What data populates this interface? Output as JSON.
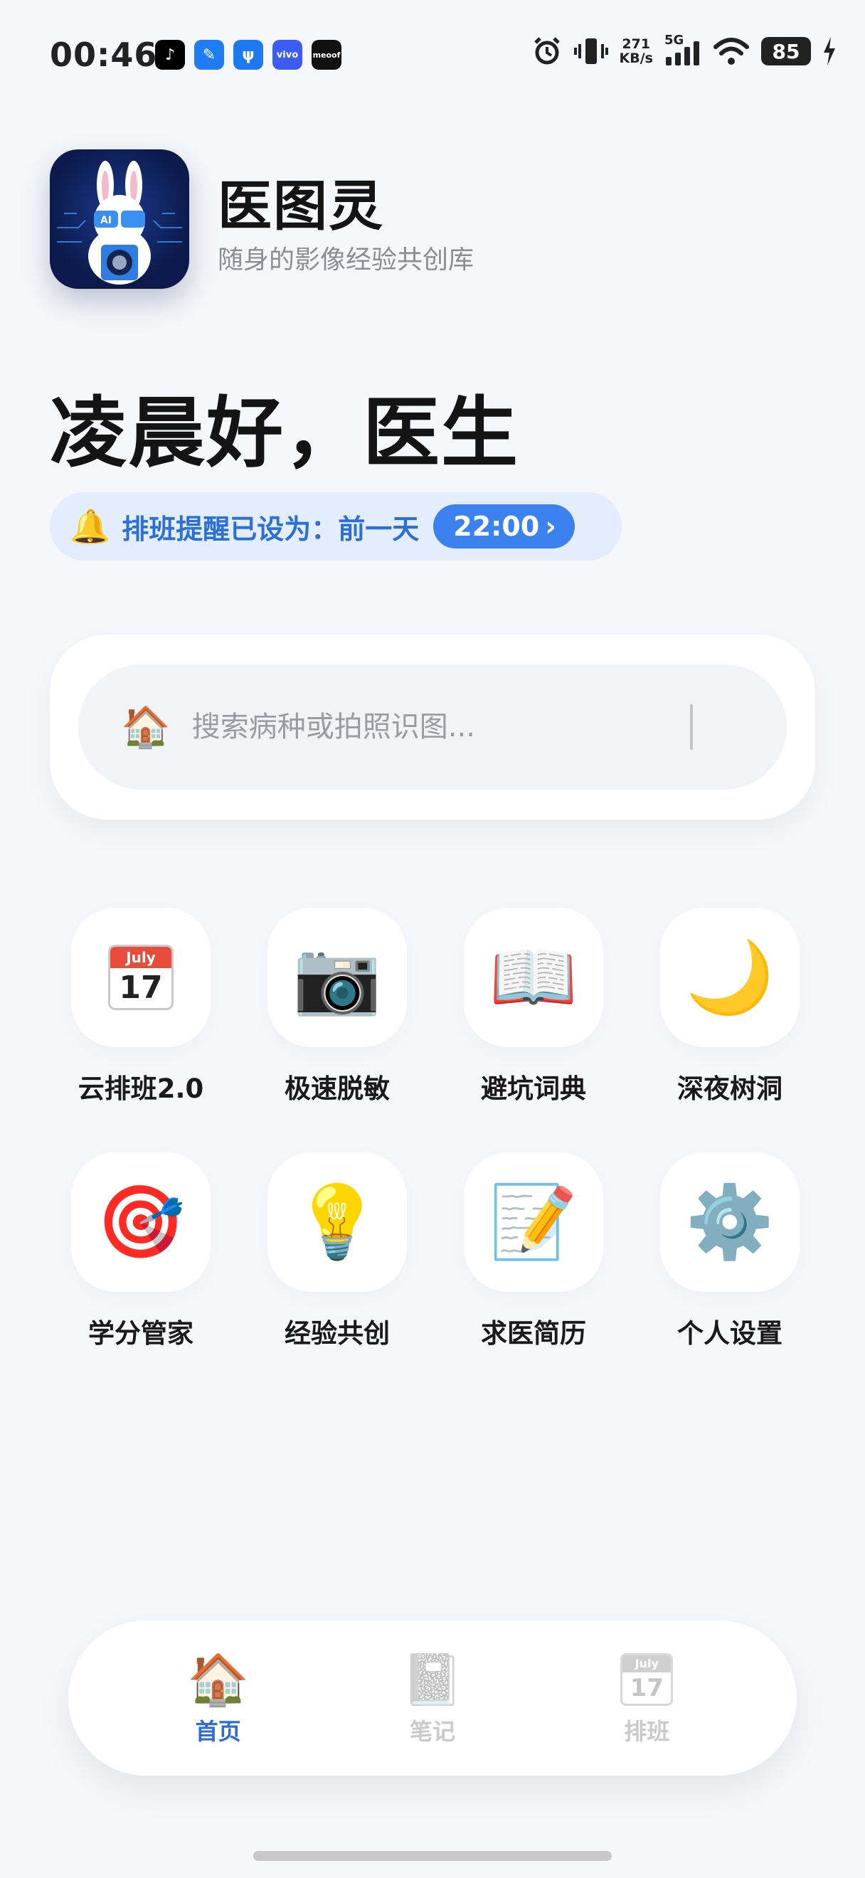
{
  "status_bar": {
    "time": "00:46",
    "notifications": [
      "tiktok-icon",
      "app-icon",
      "usb-icon",
      "vivo-icon",
      "meoof-icon"
    ],
    "vivo_label": "vivo",
    "meoof_label": "meoof",
    "net_speed_value": "271",
    "net_speed_unit": "KB/s",
    "network": "5G",
    "battery": "85"
  },
  "header": {
    "app_name": "医图灵",
    "tagline": "随身的影像经验共创库",
    "logo_text": "AI"
  },
  "greeting": "凌晨好，医生",
  "reminder": {
    "icon": "bell-icon",
    "text": "排班提醒已设为：前一天",
    "time": "22:00",
    "chevron": "›"
  },
  "search": {
    "icon": "house-icon",
    "placeholder": "搜索病种或拍照识图..."
  },
  "features": [
    {
      "label": "云排班2.0",
      "icon": "calendar-icon",
      "cal_month": "July",
      "cal_day": "17"
    },
    {
      "label": "极速脱敏",
      "icon": "camera-icon",
      "glyph": "📷"
    },
    {
      "label": "避坑词典",
      "icon": "open-book-icon",
      "glyph": "📖"
    },
    {
      "label": "深夜树洞",
      "icon": "crescent-moon-icon",
      "glyph": "🌙"
    },
    {
      "label": "学分管家",
      "icon": "target-icon",
      "glyph": "🎯"
    },
    {
      "label": "经验共创",
      "icon": "lightbulb-icon",
      "glyph": "💡"
    },
    {
      "label": "求医简历",
      "icon": "memo-icon",
      "glyph": "📝"
    },
    {
      "label": "个人设置",
      "icon": "gear-icon",
      "glyph": "⚙️"
    }
  ],
  "bottom_nav": [
    {
      "label": "首页",
      "icon": "house-icon",
      "glyph": "🏠",
      "active": true
    },
    {
      "label": "笔记",
      "icon": "notebook-icon",
      "glyph": "📓",
      "active": false
    },
    {
      "label": "排班",
      "icon": "calendar-icon",
      "cal_month": "July",
      "cal_day": "17",
      "active": false
    }
  ],
  "colors": {
    "accent": "#3b82f0",
    "accent_text": "#2d6bd0",
    "background": "#f6f7fb",
    "reminder_bg": "#e4edfb"
  }
}
